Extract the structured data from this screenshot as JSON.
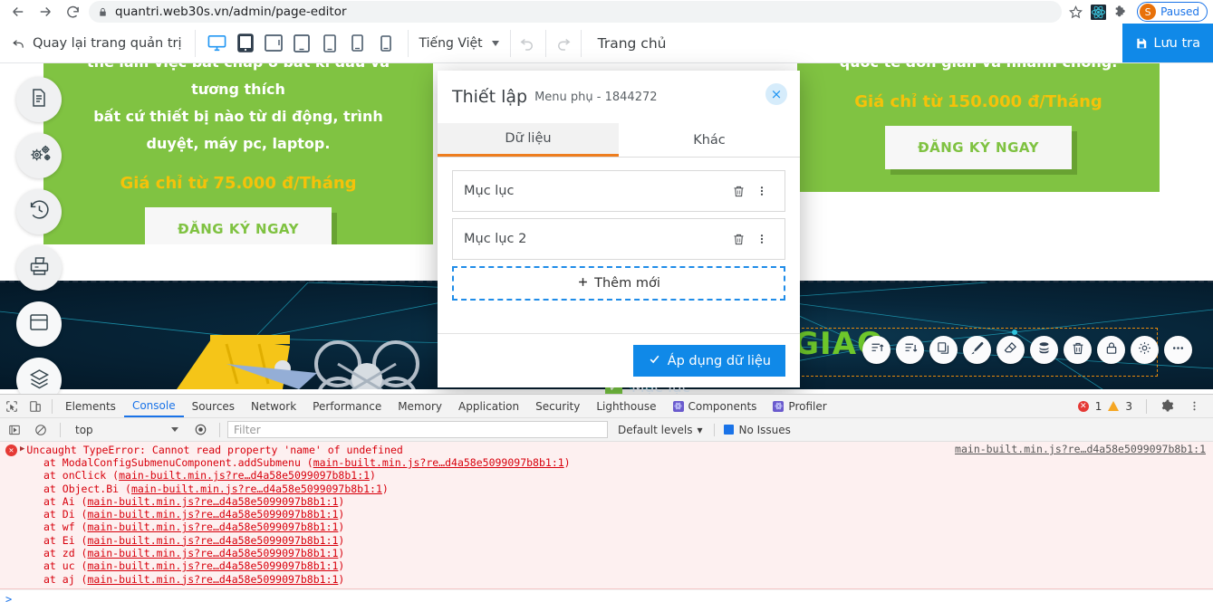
{
  "browser": {
    "url": "quantri.web30s.vn/admin/page-editor",
    "back_icon": "arrow-left-icon",
    "forward_icon": "arrow-right-icon",
    "reload_icon": "reload-icon",
    "lock_icon": "lock-icon",
    "star_icon": "star-icon",
    "extension_icons": [
      "react-devtools-icon",
      "puzzle-extension-icon"
    ],
    "profile": {
      "initial": "S",
      "label": "Paused"
    }
  },
  "toolbar": {
    "back_to_admin": "Quay lại trang quản trị",
    "back_icon": "undo-arrow-icon",
    "devices": [
      {
        "name": "device-desktop",
        "icon": "monitor-icon",
        "active": true
      },
      {
        "name": "device-tablet-landscape",
        "icon": "tablet-filled-icon",
        "active": false
      },
      {
        "name": "device-tablet",
        "icon": "tablet-icon",
        "active": false
      },
      {
        "name": "device-tablet-small",
        "icon": "tablet-small-icon",
        "active": false
      },
      {
        "name": "device-phone-large",
        "icon": "phone-large-icon",
        "active": false
      },
      {
        "name": "device-phone",
        "icon": "phone-icon",
        "active": false
      },
      {
        "name": "device-phone-small",
        "icon": "phone-small-icon",
        "active": false
      }
    ],
    "language": "Tiếng Việt",
    "undo_icon": "undo-icon",
    "redo_icon": "redo-icon",
    "page_name": "Trang chủ",
    "save_label": "Lưu tra",
    "save_icon": "save-disk-icon"
  },
  "rail": [
    {
      "name": "sidebar-pages",
      "icon": "document-icon"
    },
    {
      "name": "sidebar-settings",
      "icon": "gears-icon"
    },
    {
      "name": "sidebar-history",
      "icon": "history-icon"
    },
    {
      "name": "sidebar-print",
      "icon": "printer-icon"
    },
    {
      "name": "sidebar-sections",
      "icon": "window-layout-icon"
    },
    {
      "name": "sidebar-layers",
      "icon": "layers-icon"
    }
  ],
  "canvas": {
    "panel_left": {
      "text_clipped": "thể làm việc bất chấp ở bất kì đâu và tương thích",
      "text": "bất cứ thiết bị nào từ di động, trình duyệt, máy pc, laptop.",
      "price": "Giá chỉ từ 75.000 đ/Tháng",
      "cta": "ĐĂNG KÝ NGAY",
      "bg_color": "#80c342",
      "price_color": "#f5c20a"
    },
    "panel_right": {
      "text_clipped": "quốc tế đơn giản và nhanh chóng.",
      "price": "Giá chỉ từ 150.000 đ/Tháng",
      "cta": "ĐĂNG KÝ NGAY",
      "bg_color": "#80c342",
      "price_color": "#f5c20a"
    },
    "hero": {
      "headline": "CHUYỂN GIAO",
      "check_label": "Mục lục",
      "selection_color": "#e8890c",
      "headline_color": "#6ec72b"
    },
    "element_toolbar": [
      {
        "name": "move-up-icon"
      },
      {
        "name": "move-down-icon"
      },
      {
        "name": "duplicate-icon"
      },
      {
        "name": "paint-brush-icon"
      },
      {
        "name": "eraser-icon"
      },
      {
        "name": "database-icon"
      },
      {
        "name": "trash-icon"
      },
      {
        "name": "lock-icon"
      },
      {
        "name": "gear-icon"
      },
      {
        "name": "more-options-icon"
      }
    ]
  },
  "modal": {
    "title": "Thiết lập",
    "subtitle": "Menu phụ - 1844272",
    "close_icon": "close-icon",
    "tabs": [
      {
        "label": "Dữ liệu",
        "active": true
      },
      {
        "label": "Khác",
        "active": false
      }
    ],
    "items": [
      {
        "label": "Mục lục",
        "delete_icon": "trash-icon",
        "menu_icon": "vertical-dots-icon"
      },
      {
        "label": "Mục lục 2",
        "delete_icon": "trash-icon",
        "menu_icon": "vertical-dots-icon"
      }
    ],
    "add_label": "Thêm mới",
    "add_icon": "plus-icon",
    "apply_label": "Áp dụng dữ liệu",
    "apply_icon": "check-icon",
    "accent_color": "#ee7d1e",
    "primary_color": "#1089e8"
  },
  "devtools": {
    "inspect_icon": "inspect-element-icon",
    "device_toolbar_icon": "device-toolbar-icon",
    "tabs": [
      {
        "label": "Elements",
        "active": false
      },
      {
        "label": "Console",
        "active": true
      },
      {
        "label": "Sources",
        "active": false
      },
      {
        "label": "Network",
        "active": false
      },
      {
        "label": "Performance",
        "active": false
      },
      {
        "label": "Memory",
        "active": false
      },
      {
        "label": "Application",
        "active": false
      },
      {
        "label": "Security",
        "active": false
      },
      {
        "label": "Lighthouse",
        "active": false
      },
      {
        "label": "Components",
        "active": false,
        "badge": "react-icon"
      },
      {
        "label": "Profiler",
        "active": false,
        "badge": "react-icon"
      }
    ],
    "error_count": "1",
    "warning_count": "3",
    "settings_icon": "gear-icon",
    "more_icon": "vertical-dots-icon",
    "filterbar": {
      "execute_icon": "execute-icon",
      "clear_icon": "clear-console-icon",
      "context": "top",
      "eye_icon": "eye-icon",
      "filter_placeholder": "Filter",
      "levels_label": "Default levels",
      "no_issues_label": "No Issues"
    },
    "console": {
      "error_icon": "error-circle-icon",
      "expand_icon": "expand-triangle-icon",
      "message": "Uncaught TypeError: Cannot read property 'name' of undefined",
      "source_link": "main-built.min.js?re…d4a58e5099097b8b1:1",
      "stack": [
        {
          "at": "at ModalConfigSubmenuComponent.addSubmenu (",
          "link": "main-built.min.js?re…d4a58e5099097b8b1:1",
          "close": ")"
        },
        {
          "at": "at onClick (",
          "link": "main-built.min.js?re…d4a58e5099097b8b1:1",
          "close": ")"
        },
        {
          "at": "at Object.Bi (",
          "link": "main-built.min.js?re…d4a58e5099097b8b1:1",
          "close": ")"
        },
        {
          "at": "at Ai (",
          "link": "main-built.min.js?re…d4a58e5099097b8b1:1",
          "close": ")"
        },
        {
          "at": "at Di (",
          "link": "main-built.min.js?re…d4a58e5099097b8b1:1",
          "close": ")"
        },
        {
          "at": "at wf (",
          "link": "main-built.min.js?re…d4a58e5099097b8b1:1",
          "close": ")"
        },
        {
          "at": "at Ei (",
          "link": "main-built.min.js?re…d4a58e5099097b8b1:1",
          "close": ")"
        },
        {
          "at": "at zd (",
          "link": "main-built.min.js?re…d4a58e5099097b8b1:1",
          "close": ")"
        },
        {
          "at": "at uc (",
          "link": "main-built.min.js?re…d4a58e5099097b8b1:1",
          "close": ")"
        },
        {
          "at": "at aj (",
          "link": "main-built.min.js?re…d4a58e5099097b8b1:1",
          "close": ")"
        }
      ],
      "prompt": ">"
    }
  }
}
